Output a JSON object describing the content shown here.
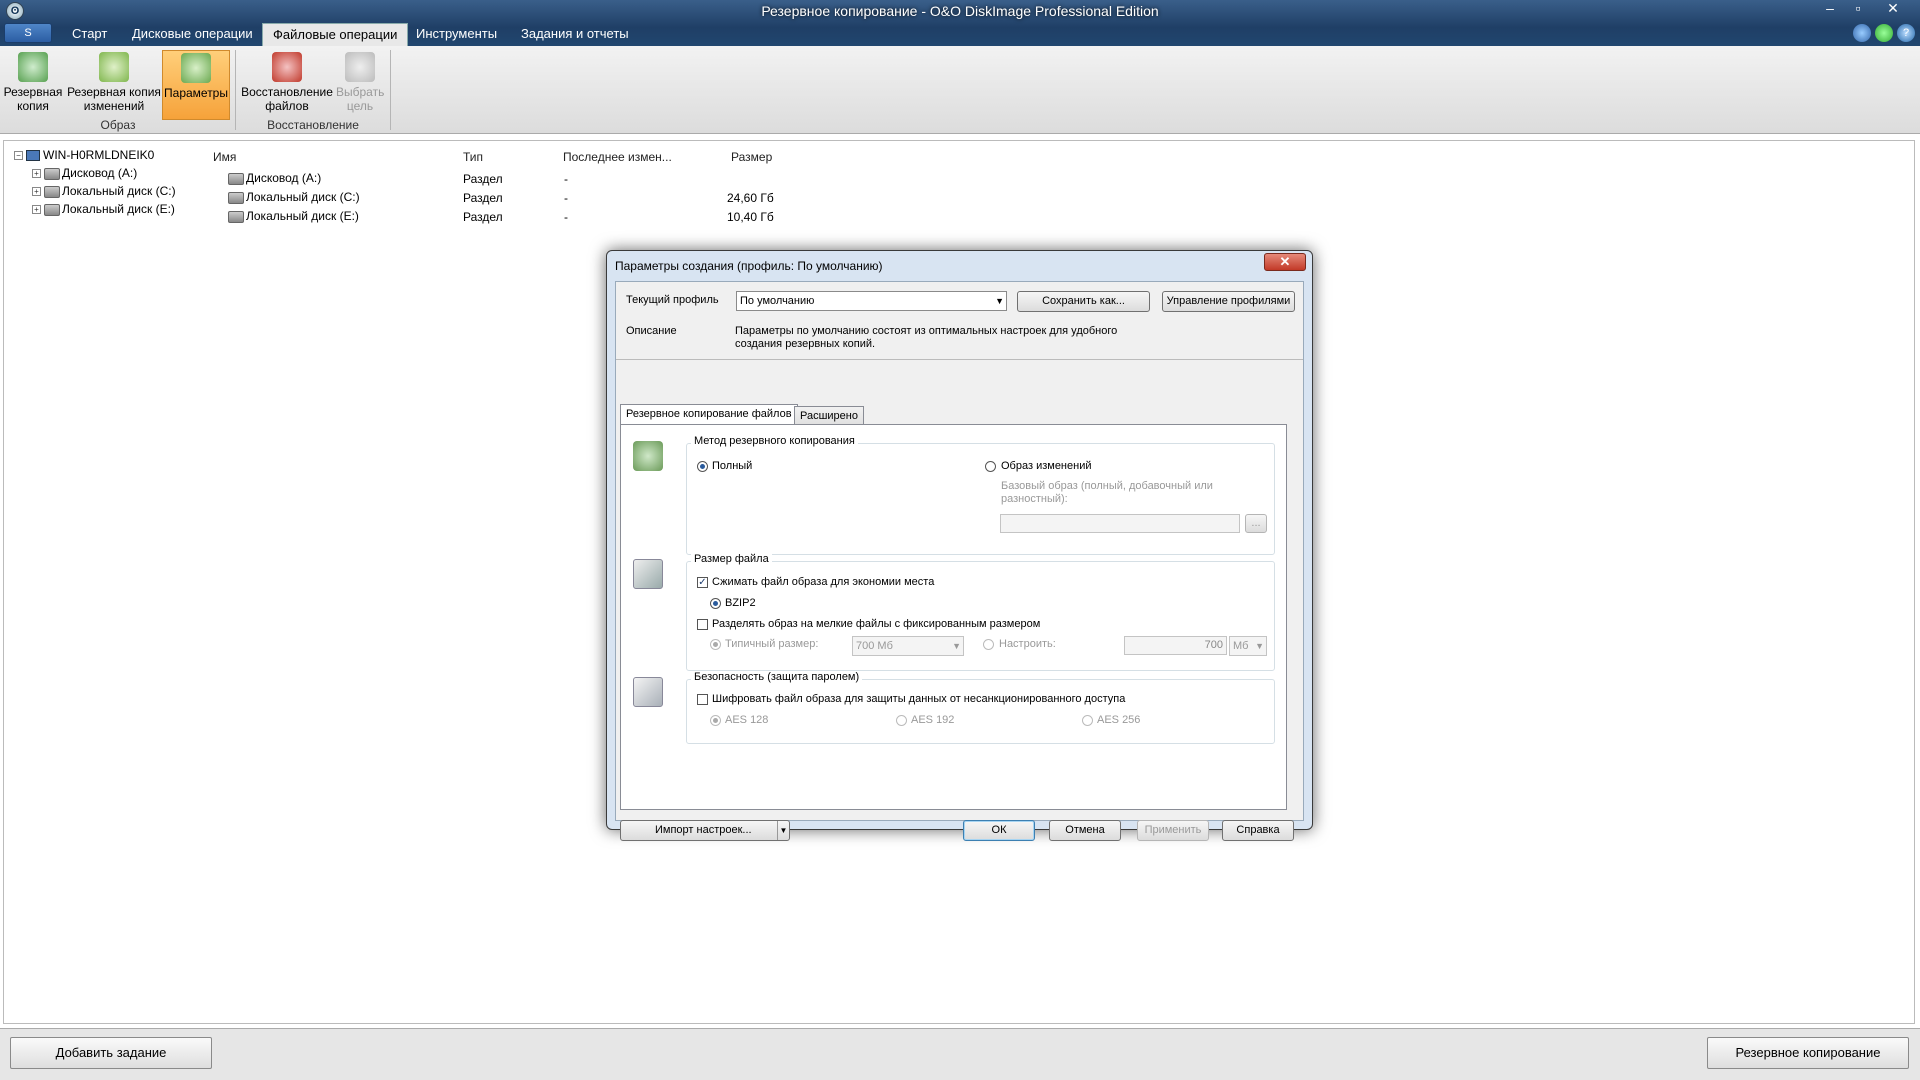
{
  "window": {
    "title": "Резервное копирование - O&O DiskImage Professional Edition",
    "app_menu_label": "S",
    "controls": {
      "minimize": "–",
      "maximize": "▫",
      "close": "✕"
    }
  },
  "ribbon": {
    "tabs": [
      "Старт",
      "Дисковые операции",
      "Файловые операции",
      "Инструменты",
      "Задания и отчеты"
    ],
    "active_tab": "Файловые операции",
    "groups": [
      {
        "label": "Образ",
        "buttons": [
          "Резервная копия",
          "Резервная копия изменений",
          "Параметры"
        ]
      },
      {
        "label": "Восстановление",
        "buttons": [
          "Восстановление файлов",
          "Выбрать цель"
        ]
      }
    ],
    "button_lines": {
      "backup": [
        "Резервная",
        "копия"
      ],
      "diff": [
        "Резервная копия",
        "изменений"
      ],
      "params": [
        "Параметры"
      ],
      "restore": [
        "Восстановление",
        "файлов"
      ],
      "target": [
        "Выбрать",
        "цель"
      ]
    }
  },
  "tree": {
    "root": "WIN-H0RMLDNEIK0",
    "items": [
      "Дисковод (A:)",
      "Локальный диск (C:)",
      "Локальный диск (E:)"
    ]
  },
  "list": {
    "columns": [
      "Имя",
      "Тип",
      "Последнее измен...",
      "Размер"
    ],
    "rows": [
      {
        "name": "Дисковод (A:)",
        "type": "Раздел",
        "modified": "-",
        "size": ""
      },
      {
        "name": "Локальный диск (C:)",
        "type": "Раздел",
        "modified": "-",
        "size": "24,60 Гб"
      },
      {
        "name": "Локальный диск (E:)",
        "type": "Раздел",
        "modified": "-",
        "size": "10,40 Гб"
      }
    ]
  },
  "dialog": {
    "title": "Параметры создания (профиль: По умолчанию)",
    "profile_label": "Текущий профиль",
    "profile_value": "По умолчанию",
    "save_as": "Сохранить как...",
    "manage_profiles": "Управление профилями",
    "description_label": "Описание",
    "description_text": "Параметры по умолчанию состоят из оптимальных настроек для удобного создания резервных копий.",
    "tabs": [
      "Резервное копирование файлов",
      "Расширено"
    ],
    "method": {
      "title": "Метод резервного копирования",
      "full": "Полный",
      "diff": "Образ изменений",
      "base_label": "Базовый образ (полный, добавочный или разностный):",
      "browse": "..."
    },
    "filesize": {
      "title": "Размер файла",
      "compress": "Сжимать файл образа для экономии места",
      "bzip": "BZIP2",
      "split": "Разделять образ на мелкие файлы с фиксированным размером",
      "typical_label": "Типичный размер:",
      "typical_value": "700 Мб",
      "custom_label": "Настроить:",
      "custom_value": "700",
      "custom_unit": "Мб"
    },
    "security": {
      "title": "Безопасность (защита паролем)",
      "encrypt": "Шифровать файл образа для защиты данных от несанкционированного доступа",
      "aes": [
        "AES 128",
        "AES 192",
        "AES 256"
      ]
    },
    "buttons": {
      "import": "Импорт настроек...",
      "ok": "ОК",
      "cancel": "Отмена",
      "apply": "Применить",
      "help": "Справка"
    }
  },
  "bottom": {
    "add_task": "Добавить задание",
    "backup": "Резервное копирование"
  }
}
